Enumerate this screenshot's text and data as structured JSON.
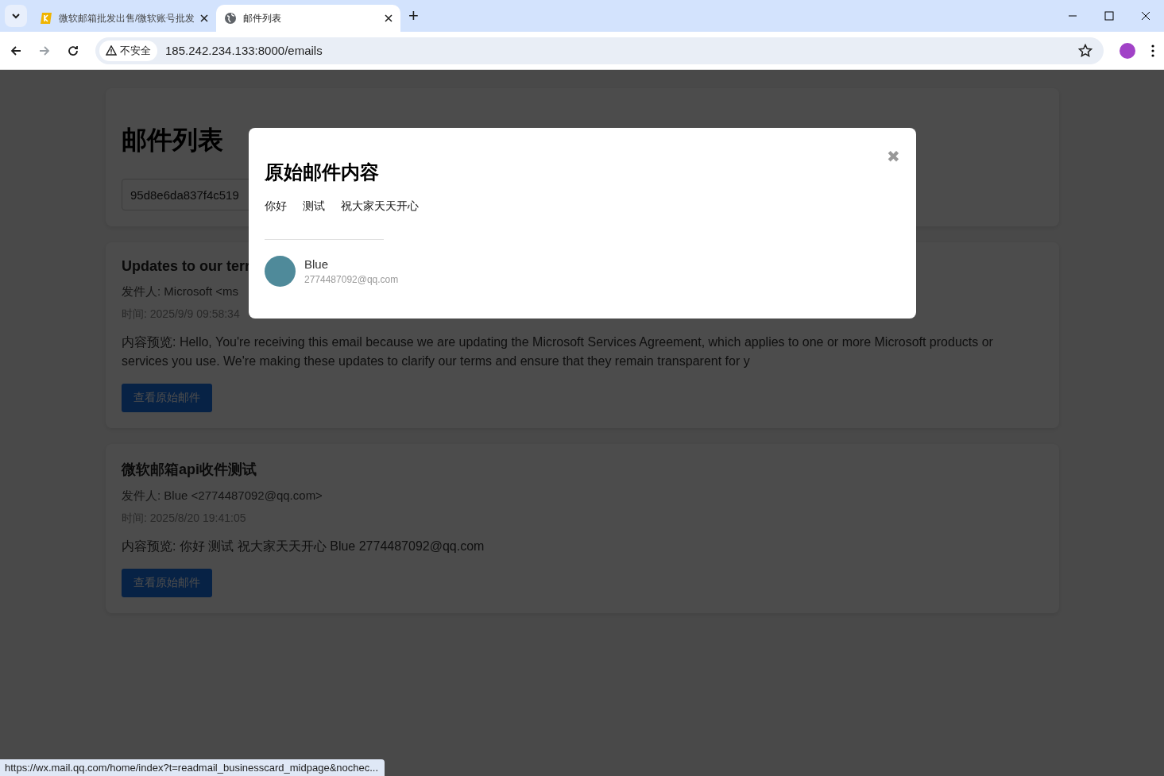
{
  "browser": {
    "tabs": [
      {
        "title": "微软邮箱批发出售/微软账号批发",
        "kind": "site",
        "selected": false
      },
      {
        "title": "邮件列表",
        "kind": "globe",
        "selected": true
      }
    ],
    "new_tab": "+",
    "security": "不安全",
    "url": "185.242.234.133:8000/emails"
  },
  "page": {
    "title": "邮件列表",
    "search_value": "95d8e6da837f4c519",
    "emails": [
      {
        "subject": "Updates to our terr",
        "sender": "发件人: Microsoft <ms",
        "time": "时间: 2025/9/9 09:58:34",
        "preview": "内容预览: Hello, You're receiving this email because we are updating the Microsoft Services Agreement, which applies to one or more Microsoft products or services you use. We're making these updates to clarify our terms and ensure that they remain transparent for y",
        "button": "查看原始邮件"
      },
      {
        "subject": "微软邮箱api收件测试",
        "sender": "发件人: Blue <2774487092@qq.com>",
        "time": "时间: 2025/8/20 19:41:05",
        "preview": "内容预览: 你好 测试 祝大家天天开心 Blue 2774487092@qq.com",
        "button": "查看原始邮件"
      }
    ]
  },
  "modal": {
    "title": "原始邮件内容",
    "close": "✖",
    "words": [
      "你好",
      "测试",
      "祝大家天天开心"
    ],
    "signature": {
      "name": "Blue",
      "email": "2774487092@qq.com"
    }
  },
  "status_url": "https://wx.mail.qq.com/home/index?t=readmail_businesscard_midpage&nochec..."
}
